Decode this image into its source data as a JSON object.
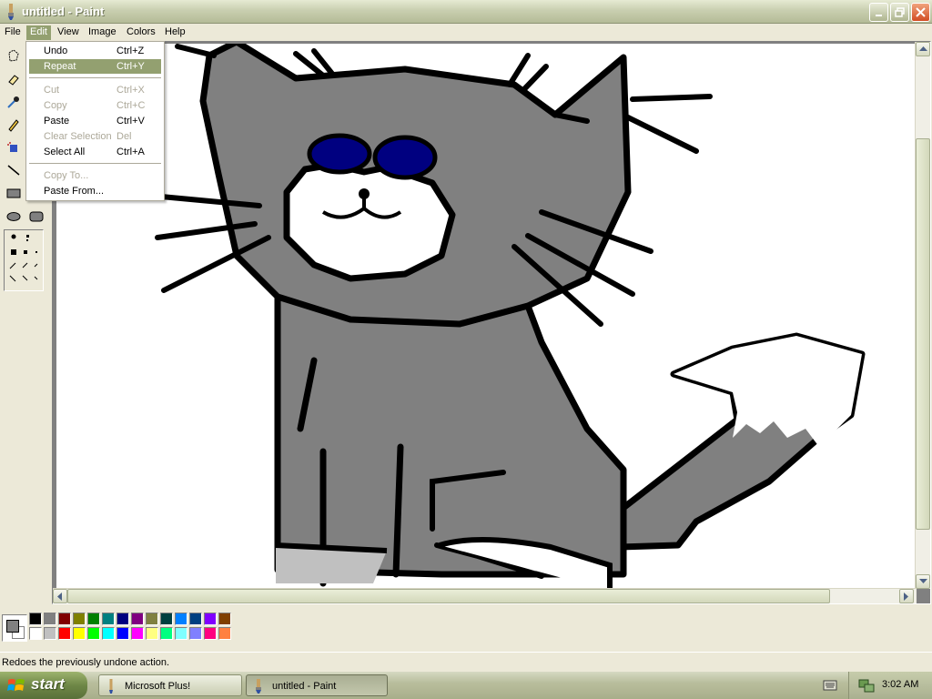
{
  "window": {
    "title": "untitled - Paint"
  },
  "menubar": [
    "File",
    "Edit",
    "View",
    "Image",
    "Colors",
    "Help"
  ],
  "edit_menu": {
    "items": [
      {
        "label": "Undo",
        "shortcut": "Ctrl+Z",
        "enabled": true
      },
      {
        "label": "Repeat",
        "shortcut": "Ctrl+Y",
        "enabled": true,
        "highlighted": true
      },
      {
        "label": "Cut",
        "shortcut": "Ctrl+X",
        "enabled": false
      },
      {
        "label": "Copy",
        "shortcut": "Ctrl+C",
        "enabled": false
      },
      {
        "label": "Paste",
        "shortcut": "Ctrl+V",
        "enabled": true
      },
      {
        "label": "Clear Selection",
        "shortcut": "Del",
        "enabled": false
      },
      {
        "label": "Select All",
        "shortcut": "Ctrl+A",
        "enabled": true
      },
      {
        "label": "Copy To...",
        "shortcut": "",
        "enabled": false
      },
      {
        "label": "Paste From...",
        "shortcut": "",
        "enabled": true
      }
    ]
  },
  "tools": [
    "free-form-select-icon",
    "select-icon",
    "eraser-icon",
    "fill-icon",
    "color-picker-icon",
    "magnifier-icon",
    "pencil-icon",
    "brush-icon",
    "airbrush-icon",
    "text-icon",
    "line-icon",
    "curve-icon",
    "rectangle-icon",
    "polygon-icon",
    "ellipse-icon",
    "rounded-rectangle-icon"
  ],
  "palette": {
    "foreground": "#808080",
    "background": "#ffffff",
    "row1": [
      "#000000",
      "#808080",
      "#800000",
      "#808000",
      "#008000",
      "#008080",
      "#000080",
      "#800080",
      "#808040",
      "#004040",
      "#0080ff",
      "#004080",
      "#8000ff",
      "#804000"
    ],
    "row2": [
      "#ffffff",
      "#c0c0c0",
      "#ff0000",
      "#ffff00",
      "#00ff00",
      "#00ffff",
      "#0000ff",
      "#ff00ff",
      "#ffff80",
      "#00ff80",
      "#80ffff",
      "#8080ff",
      "#ff0080",
      "#ff8040"
    ]
  },
  "statusbar": {
    "text": "Redoes the previously undone action."
  },
  "taskbar": {
    "start_label": "start",
    "tasks": [
      {
        "label": "Microsoft Plus!",
        "active": false
      },
      {
        "label": "untitled - Paint",
        "active": true
      }
    ],
    "clock": "3:02 AM"
  }
}
